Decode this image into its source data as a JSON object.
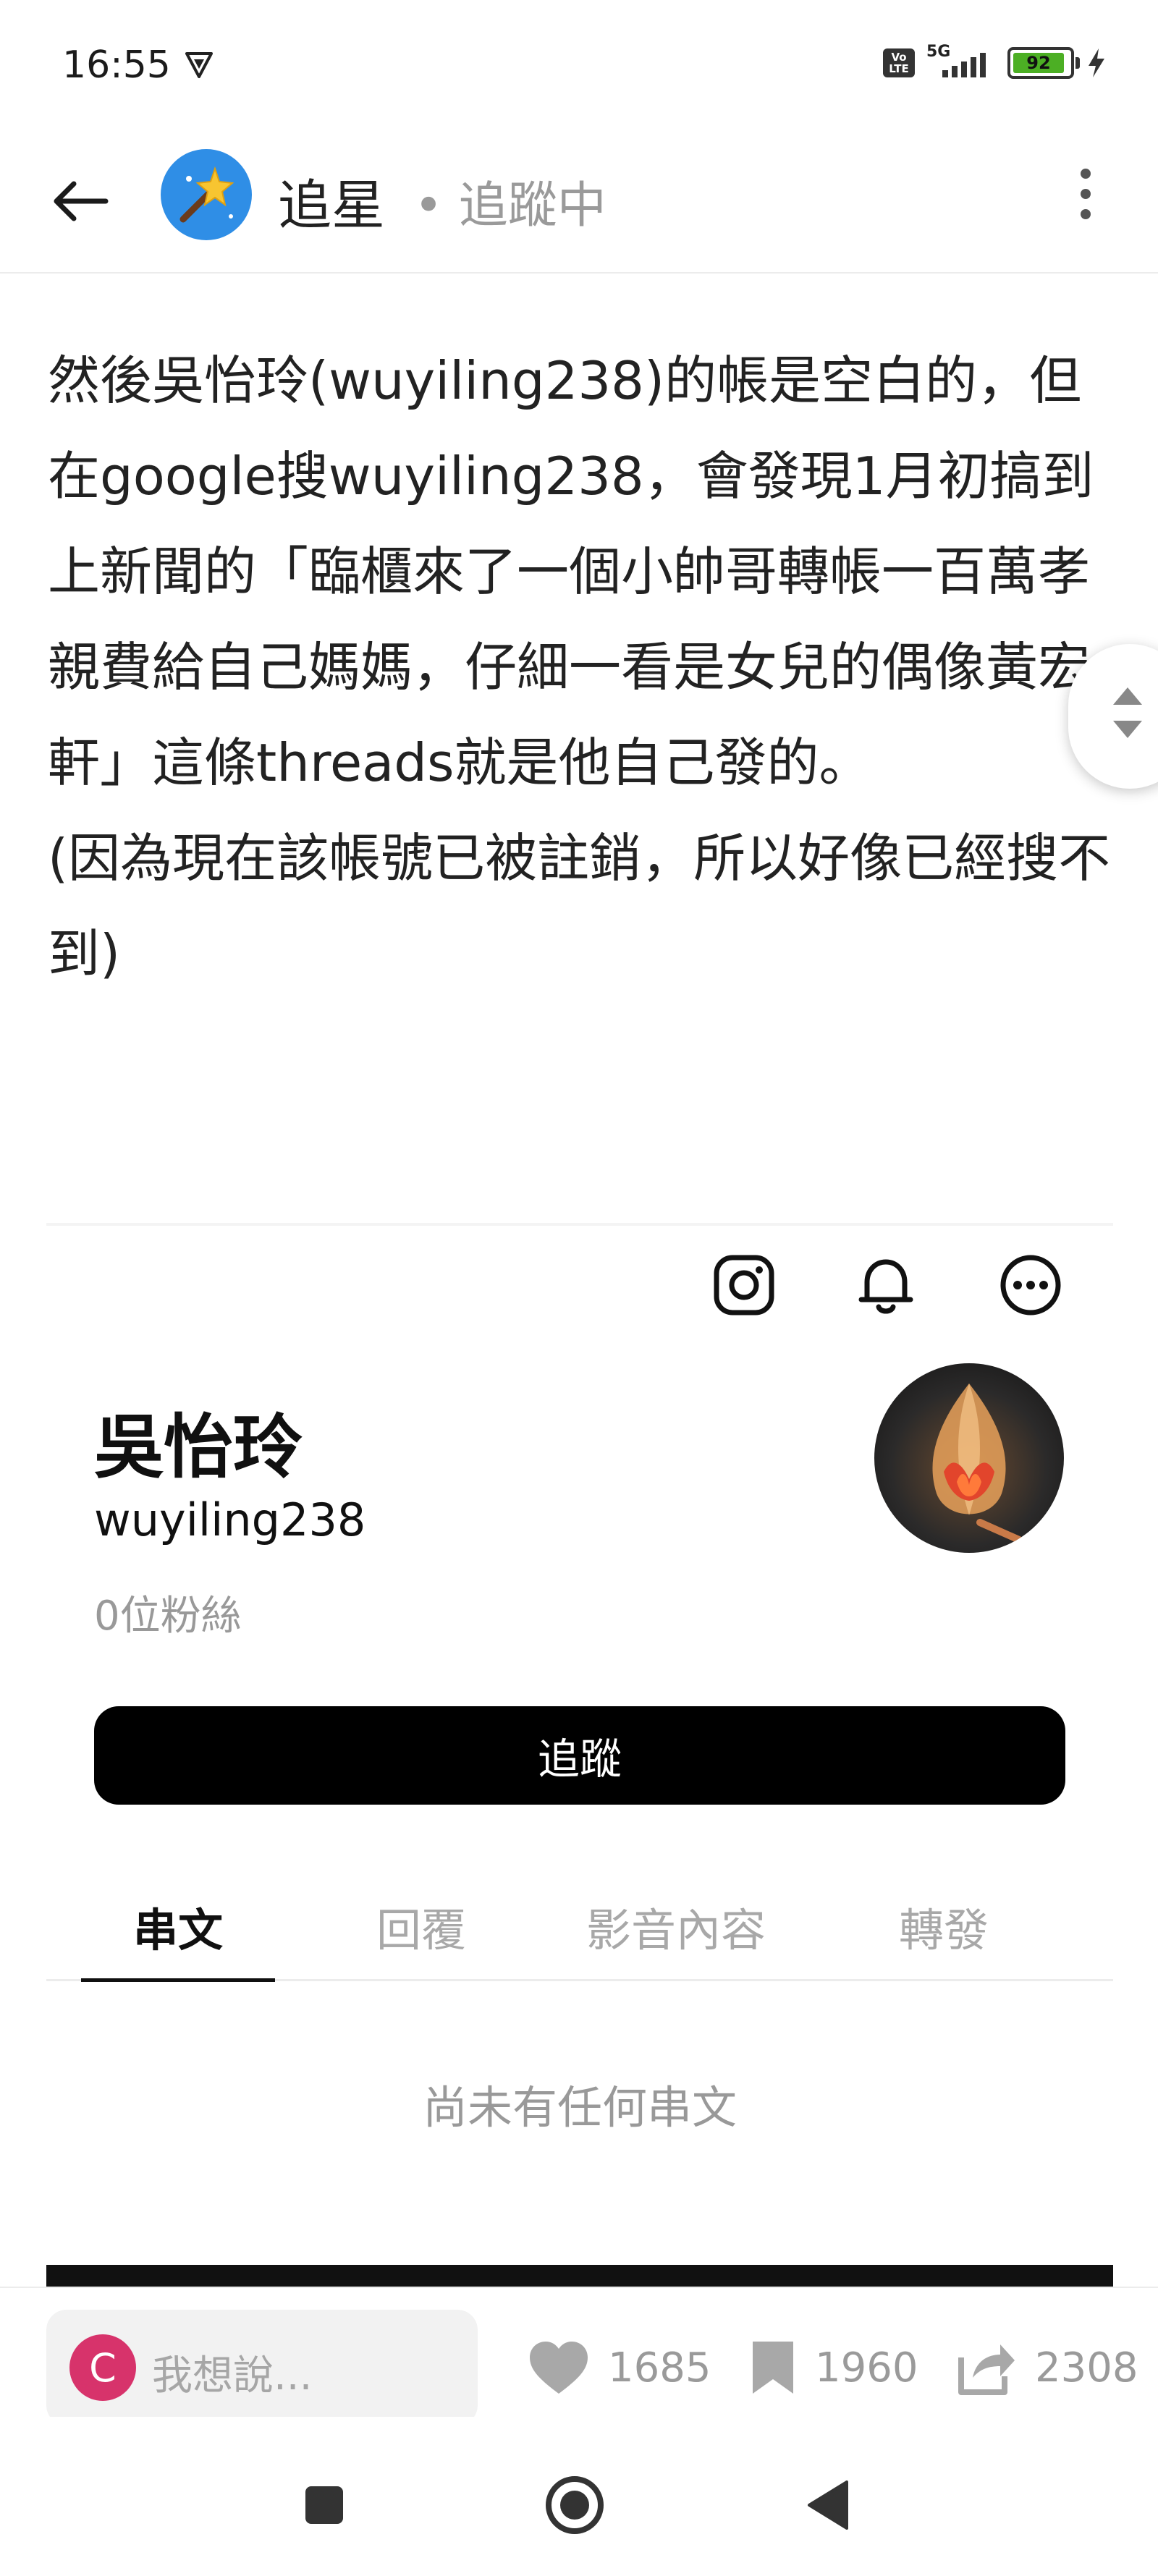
{
  "status_bar": {
    "time": "16:55",
    "network": "5G",
    "volte": "Vo LTE",
    "battery": "92",
    "battery_level": 0.92
  },
  "header": {
    "board_name": "追星",
    "follow_status": "• 追蹤中",
    "back_icon": "arrow-left-icon",
    "more_icon": "more-vertical-icon"
  },
  "article": {
    "paragraph_1": "然後吳怡玲(wuyiling238)的帳是空白的，但在google搜wuyiling238，會發現1月初搞到上新聞的「臨櫃來了一個小帥哥轉帳一百萬孝親費給自己媽媽，仔細一看是女兒的偶像黃宏軒」這條threads就是他自己發的。",
    "paragraph_2": "(因為現在該帳號已被註銷，所以好像已經搜不到)"
  },
  "embed": {
    "profile_name": "吳怡玲",
    "profile_handle": "wuyiling238",
    "followers": "0位粉絲",
    "follow_button": "追蹤",
    "tabs": [
      {
        "label": "串文",
        "active": true
      },
      {
        "label": "回覆",
        "active": false
      },
      {
        "label": "影音內容",
        "active": false
      },
      {
        "label": "轉發",
        "active": false
      }
    ],
    "empty_state": "尚未有任何串文"
  },
  "action_bar": {
    "comment_avatar_letter": "C",
    "comment_placeholder": "我想說...",
    "likes": "1685",
    "bookmarks": "1960",
    "shares": "2308"
  },
  "colors": {
    "accent_avatar": "#d7336b",
    "board_avatar": "#2f8ee6",
    "battery": "#4caf24"
  }
}
